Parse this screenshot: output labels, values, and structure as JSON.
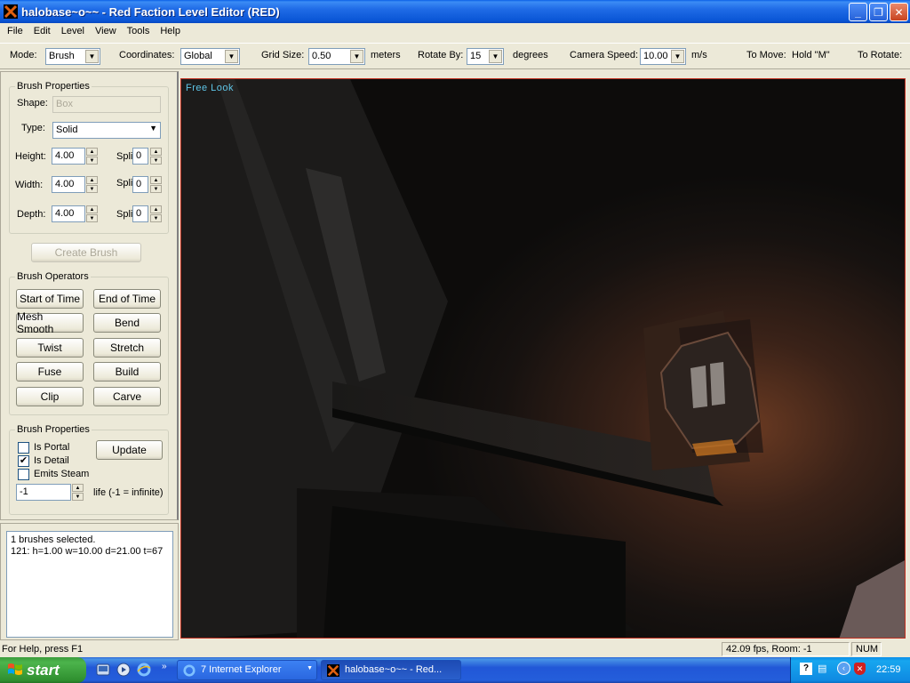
{
  "window": {
    "title": "halobase~o~~ - Red Faction Level Editor (RED)",
    "controls": [
      "_",
      "❐",
      "✕"
    ]
  },
  "menu": [
    "File",
    "Edit",
    "Level",
    "View",
    "Tools",
    "Help"
  ],
  "toolbar": {
    "mode_label": "Mode:",
    "mode_value": "Brush",
    "coords_label": "Coordinates:",
    "coords_value": "Global",
    "grid_label": "Grid Size:",
    "grid_value": "0.50",
    "grid_unit": "meters",
    "rotate_label": "Rotate By:",
    "rotate_value": "15",
    "rotate_unit": "degrees",
    "camera_label": "Camera Speed:",
    "camera_value": "10.00",
    "camera_unit": "m/s",
    "tomove_label": "To Move:",
    "tomove_value": "Hold \"M\"",
    "torotate_label": "To Rotate:"
  },
  "brush_properties": {
    "title": "Brush Properties",
    "shape_label": "Shape:",
    "shape_value": "Box",
    "type_label": "Type:",
    "type_value": "Solid",
    "height_label": "Height:",
    "height_value": "4.00",
    "width_label": "Width:",
    "width_value": "4.00",
    "depth_label": "Depth:",
    "depth_value": "4.00",
    "split_label": "Split:",
    "split_height": "0",
    "split_width": "0",
    "split_depth": "0",
    "create_button": "Create Brush"
  },
  "brush_operators": {
    "title": "Brush Operators",
    "buttons": [
      "Start of Time",
      "End of Time",
      "Mesh Smooth",
      "Bend",
      "Twist",
      "Stretch",
      "Fuse",
      "Build",
      "Clip",
      "Carve"
    ]
  },
  "brush_flags": {
    "title": "Brush Properties",
    "is_portal": "Is Portal",
    "is_detail": "Is Detail",
    "emits_steam": "Emits Steam",
    "update_button": "Update",
    "life_value": "-1",
    "life_label": "life (-1 = infinite)"
  },
  "output": {
    "line1": "1 brushes selected.",
    "line2": "121: h=1.00 w=10.00 d=21.00 t=67"
  },
  "viewport": {
    "label": "Free Look"
  },
  "status": {
    "help": "For Help, press F1",
    "fps": "42.09 fps, Room: -1",
    "num": "NUM"
  },
  "taskbar": {
    "start": "start",
    "task1": "7 Internet Explorer",
    "task2": "halobase~o~~ - Red...",
    "clock": "22:59"
  }
}
